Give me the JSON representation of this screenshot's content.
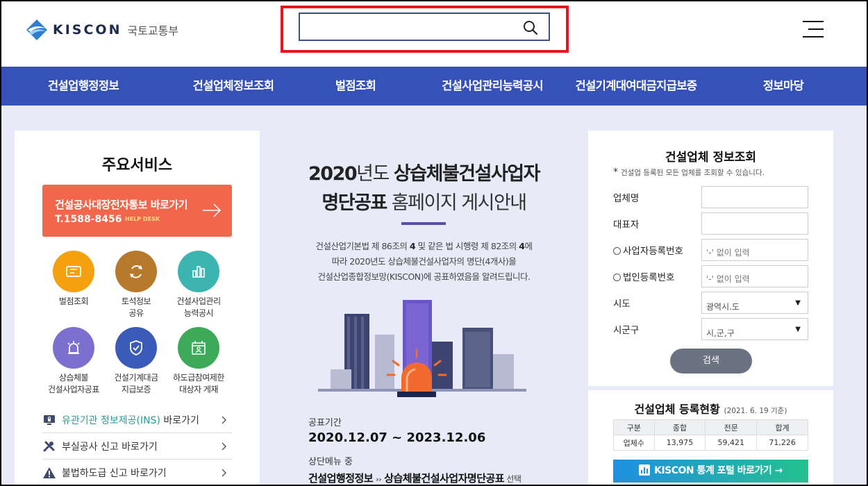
{
  "header": {
    "logo_text": "KISCON",
    "logo_sub": "국토교통부",
    "search_placeholder": ""
  },
  "nav": {
    "items": [
      {
        "label": "건설업행정정보"
      },
      {
        "label": "건설업체정보조회"
      },
      {
        "label": "벌점조회"
      },
      {
        "label": "건설사업관리능력공시"
      },
      {
        "label": "건설기계대여대금지급보증"
      },
      {
        "label": "정보마당"
      }
    ]
  },
  "left": {
    "title": "주요서비스",
    "banner": {
      "title": "건설공사대장전자통보 바로가기",
      "phone": "T.1588-8456",
      "help": "HELP DESK"
    },
    "services": [
      {
        "line1": "벌점조회",
        "line2": "",
        "color": "#f5a00f",
        "icon": "ticket-icon"
      },
      {
        "line1": "토석정보",
        "line2": "공유",
        "color": "#b77a2c",
        "icon": "recycle-icon"
      },
      {
        "line1": "건설사업관리",
        "line2": "능력공시",
        "color": "#3cb4b0",
        "icon": "bar-chart-icon"
      },
      {
        "line1": "상습체불",
        "line2": "건설사업자공표",
        "color": "#7c6fcf",
        "icon": "siren-icon"
      },
      {
        "line1": "건설기계대금",
        "line2": "지급보증",
        "color": "#3a5bb8",
        "icon": "shield-check-icon"
      },
      {
        "line1": "하도급참여제한",
        "line2": "대상자 게재",
        "color": "#3daa5a",
        "icon": "calendar-person-icon"
      }
    ],
    "links": [
      {
        "highlight": "유관기관 정보제공(INS)",
        "text": " 바로가기",
        "icon": "monitor-lock-icon"
      },
      {
        "highlight": "",
        "text": "부실공사 신고 바로가기",
        "icon": "tools-icon"
      },
      {
        "highlight": "",
        "text": "불법하도급 신고 바로가기",
        "icon": "warning-icon"
      }
    ]
  },
  "center": {
    "title1_bold": "2020",
    "title1_thin": "년도 ",
    "title1_bold2": "상습체불건설사업자",
    "title2_bold": "명단공표",
    "title2_thin": " 홈페이지 게시안내",
    "desc_line1_a": "건설산업기본법 제 86조의 ",
    "desc_line1_b": "4",
    "desc_line1_c": " 및 같은 법 시행령 제 82조의 ",
    "desc_line1_d": "4",
    "desc_line1_e": "에",
    "desc_line2": "따라 2020년도 상습체불건설사업자의 명단(4개사)을",
    "desc_line3": "건설산업종합정보망(KISCON)에 공표하였음을 알려드립니다.",
    "period_label": "공표기간",
    "period": "2020.12.07 ~ 2023.12.06",
    "top_label": "상단메뉴 중",
    "path_a": "건설업행정정보",
    "path_arrow": "››",
    "path_b": "상습체불건설사업자명단공표",
    "path_sel": " 선택"
  },
  "search_form": {
    "title": "건설업체 정보조회",
    "note": "건설업 등록된 모든 업체를 조회할 수 있습니다.",
    "fields": {
      "company_label": "업체명",
      "ceo_label": "대표자",
      "bizno_label": "사업자등록번호",
      "bizno_placeholder": "'-' 없이 입력",
      "corpno_label": "법인등록번호",
      "corpno_placeholder": "'-' 없이 입력",
      "sido_label": "시도",
      "sido_value": "광역시.도",
      "sigungu_label": "시군구",
      "sigungu_value": "시,군,구"
    },
    "submit": "검색"
  },
  "stats": {
    "title": "건설업체 등록현황",
    "date": "(2021. 6. 19 기준)",
    "headers": [
      "구분",
      "종합",
      "전문",
      "합계"
    ],
    "row": [
      "업체수",
      "13,975",
      "59,421",
      "71,226"
    ],
    "portal": "KISCON 통계 포털 바로가기 →"
  },
  "colors": {
    "nav": "#3652b8",
    "banner": "#f2664b",
    "highlight_border": "#e8151e"
  }
}
